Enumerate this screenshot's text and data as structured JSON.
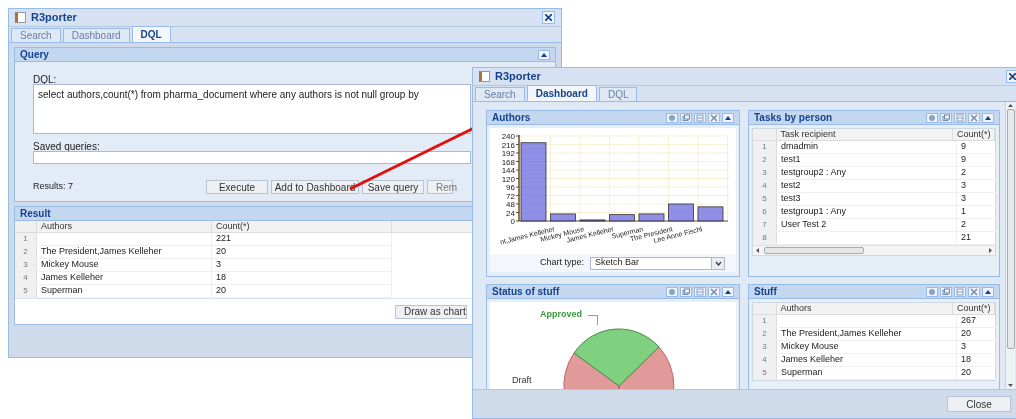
{
  "left_window": {
    "title": "R3porter",
    "tabs": [
      {
        "label": "Search",
        "selected": false
      },
      {
        "label": "Dashboard",
        "selected": false
      },
      {
        "label": "DQL",
        "selected": true
      }
    ],
    "query_panel": {
      "title": "Query",
      "dql_label": "DQL:",
      "dql_value": "select authors,count(*) from pharma_document where any authors is not null group by",
      "saved_label": "Saved queries:",
      "results": "Results: 7",
      "buttons": [
        "Execute",
        "Add to Dashboard",
        "Save query",
        "Rem"
      ]
    },
    "result_panel": {
      "title": "Result",
      "columns": [
        "Authors",
        "Count(*)"
      ],
      "rows": [
        {
          "index": "1",
          "count": "221"
        },
        {
          "index": "2",
          "author": "The President,James Kelleher",
          "count": "20"
        },
        {
          "index": "3",
          "author": "Mickey Mouse",
          "count": "3"
        },
        {
          "index": "4",
          "author": "James Kelleher",
          "count": "18"
        },
        {
          "index": "5",
          "author": "Superman",
          "count": "20"
        }
      ],
      "draw_button": "Draw as chart"
    }
  },
  "right_window": {
    "title": "R3porter",
    "tabs": [
      {
        "label": "Search",
        "selected": false
      },
      {
        "label": "Dashboard",
        "selected": true
      },
      {
        "label": "DQL",
        "selected": false
      }
    ],
    "portlets": [
      {
        "kind": "chart",
        "title": "Authors",
        "chart_type_label": "Chart type:",
        "chart_type_value": "Sketch Bar",
        "chart_data": {
          "type": "bar",
          "categories": [
            null,
            "nt,James Kelleher",
            "Mickey Mouse",
            "James Kelleher",
            "Superman",
            "The President",
            "Lee Anne Fischl"
          ],
          "series": [
            {
              "color": "#6a6ae0",
              "values": [
                221,
                20,
                3,
                18,
                20,
                48,
                40
              ]
            }
          ],
          "grid": true,
          "ylim": [
            0,
            240
          ],
          "yticks": [
            0,
            24,
            48,
            72,
            96,
            120,
            144,
            168,
            192,
            216,
            240
          ]
        }
      },
      {
        "kind": "table",
        "title": "Tasks by person",
        "columns": [
          "Task recipient",
          "Count(*)"
        ],
        "scrollable": true,
        "rows": [
          {
            "index": "1",
            "author": "dmadmin",
            "count": "9"
          },
          {
            "index": "2",
            "author": "test1",
            "count": "9"
          },
          {
            "index": "3",
            "author": "testgroup2 : Any",
            "count": "2"
          },
          {
            "index": "4",
            "author": "test2",
            "count": "3"
          },
          {
            "index": "5",
            "author": "test3",
            "count": "3"
          },
          {
            "index": "6",
            "author": "testgroup1 : Any",
            "count": "1"
          },
          {
            "index": "7",
            "author": "User Test 2",
            "count": "2"
          },
          {
            "index": "8",
            "count": "21"
          }
        ]
      },
      {
        "kind": "pie",
        "title": "Status of stuff",
        "slices": [
          {
            "label": "Approved",
            "color": "#7fd07f"
          },
          {
            "label": "Draft",
            "color": "#e09a9a"
          }
        ]
      },
      {
        "kind": "table",
        "title": "Stuff",
        "columns": [
          "Authors",
          "Count(*)"
        ],
        "rows": [
          {
            "index": "1",
            "count": "267"
          },
          {
            "index": "2",
            "author": "The President,James Kelleher",
            "count": "20"
          },
          {
            "index": "3",
            "author": "Mickey Mouse",
            "count": "3"
          },
          {
            "index": "4",
            "author": "James Kelleher",
            "count": "18"
          },
          {
            "index": "5",
            "author": "Superman",
            "count": "20"
          }
        ]
      }
    ],
    "close_button": "Close"
  }
}
